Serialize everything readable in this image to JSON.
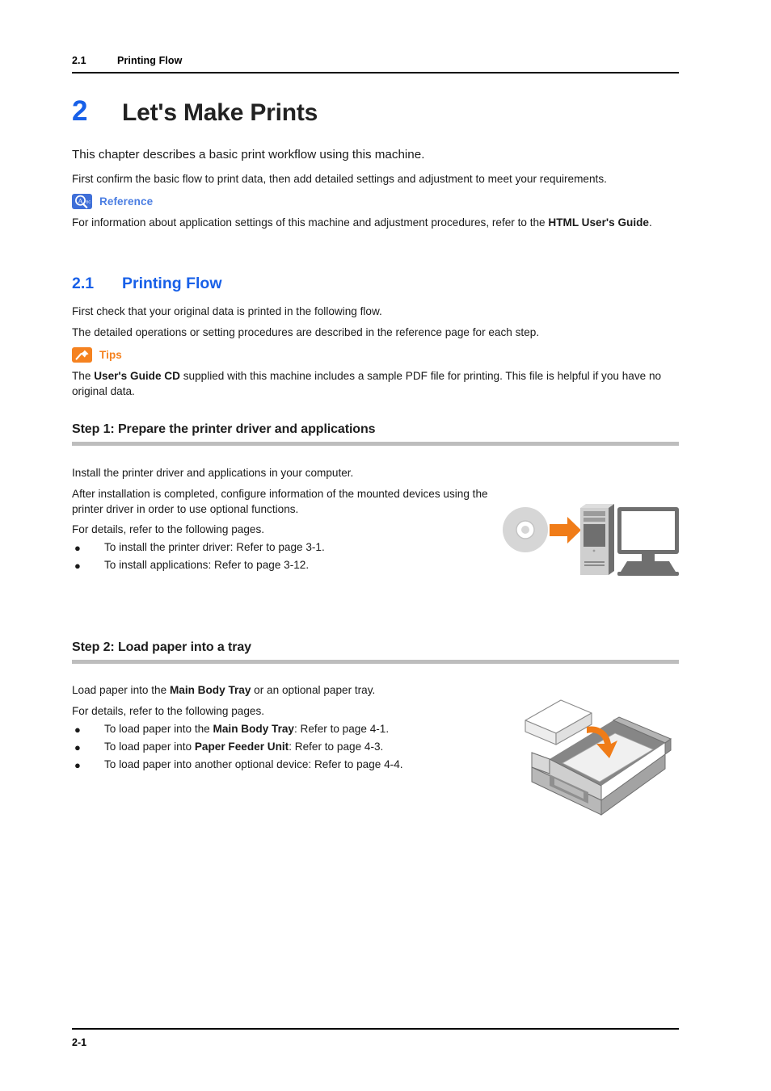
{
  "header": {
    "section_number": "2.1",
    "section_name": "Printing Flow"
  },
  "chapter": {
    "number": "2",
    "title": "Let's Make Prints"
  },
  "intro": {
    "lead": "This chapter describes a basic print workflow using this machine.",
    "sub": "First confirm the basic flow to print data, then add detailed settings and adjustment to meet your requirements."
  },
  "reference_note": {
    "icon": "reference-magnifier-icon",
    "label": "Reference",
    "body_pre": "For information about application settings of this machine and adjustment procedures, refer to the ",
    "body_bold": "HTML User's Guide",
    "body_post": "."
  },
  "section": {
    "number": "2.1",
    "title": "Printing Flow",
    "para1": "First check that your original data is printed in the following flow.",
    "para2": "The detailed operations or setting procedures are described in the reference page for each step."
  },
  "tips_note": {
    "icon": "tips-pushpin-icon",
    "label": "Tips",
    "body_pre": "The ",
    "body_bold": "User's Guide CD",
    "body_post": " supplied with this machine includes a sample PDF file for printing. This file is helpful if you have no original data."
  },
  "step1": {
    "heading": "Step 1: Prepare the printer driver and applications",
    "para1": "Install the printer driver and applications in your computer.",
    "para2": "After installation is completed, configure information of the mounted devices using the printer driver in order to use optional functions.",
    "para3": "For details, refer to the following pages.",
    "bullet_marker": "●",
    "bullets": [
      "To install the printer driver: Refer to page 3-1.",
      "To install applications: Refer to page 3-12."
    ],
    "figure": "cd-to-computer-illustration"
  },
  "step2": {
    "heading": "Step 2: Load paper into a tray",
    "para1_pre": "Load paper into the ",
    "para1_bold": "Main Body Tray",
    "para1_post": " or an optional paper tray.",
    "para2": "For details, refer to the following pages.",
    "bullet_marker": "●",
    "bullets": [
      {
        "pre": "To load paper into the ",
        "bold": "Main Body Tray",
        "post": ": Refer to page 4-1."
      },
      {
        "pre": "To load paper into ",
        "bold": "Paper Feeder Unit",
        "post": ": Refer to page 4-3."
      },
      {
        "pre": "To load paper into another optional device: Refer to page 4-4.",
        "bold": "",
        "post": ""
      }
    ],
    "figure": "paper-tray-loading-illustration"
  },
  "footer": {
    "page_number": "2-1"
  },
  "colors": {
    "heading_blue": "#1860e8",
    "reference_blue": "#4a7de2",
    "tips_orange": "#f58220",
    "rule_gray": "#bdbdbd",
    "text_black": "#1a1a1a"
  }
}
